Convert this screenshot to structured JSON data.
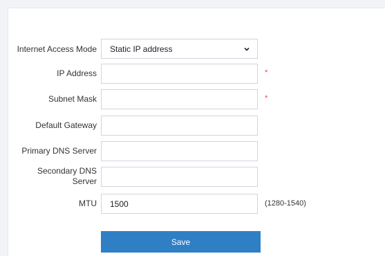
{
  "form": {
    "internet_access_mode": {
      "label": "Internet Access Mode",
      "selected": "Static IP address"
    },
    "ip_address": {
      "label": "IP Address",
      "value": "",
      "required_mark": "*"
    },
    "subnet_mask": {
      "label": "Subnet Mask",
      "value": "",
      "required_mark": "*"
    },
    "default_gateway": {
      "label": "Default Gateway",
      "value": ""
    },
    "primary_dns": {
      "label": "Primary DNS Server",
      "value": ""
    },
    "secondary_dns": {
      "label_line1": "Secondary DNS",
      "label_line2": "Server",
      "value": ""
    },
    "mtu": {
      "label": "MTU",
      "value": "1500",
      "range_hint": "(1280-1540)"
    },
    "save_label": "Save"
  },
  "colors": {
    "primary": "#2f7fc4",
    "required": "#e8473c"
  }
}
